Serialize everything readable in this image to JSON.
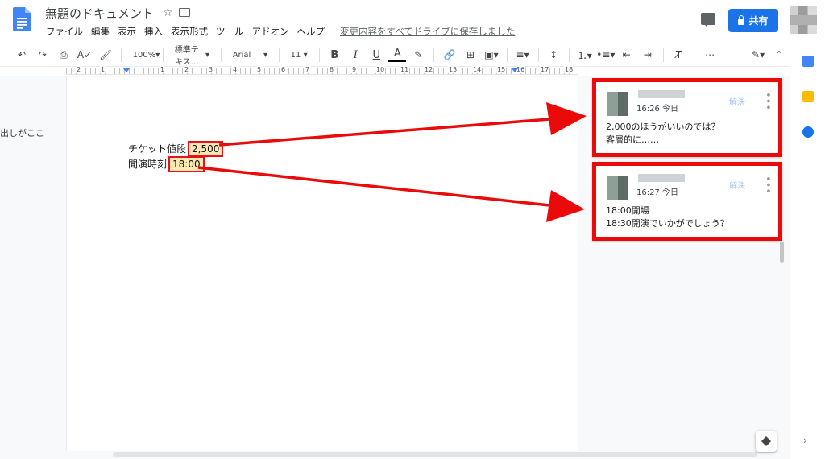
{
  "header": {
    "doc_title": "無題のドキュメント",
    "menu": [
      "ファイル",
      "編集",
      "表示",
      "挿入",
      "表示形式",
      "ツール",
      "アドオン",
      "ヘルプ"
    ],
    "save_status": "変更内容をすべてドライブに保存しました",
    "share_label": "共有"
  },
  "toolbar": {
    "zoom": "100%",
    "style": "標準テキス…",
    "font": "Arial",
    "size": "11",
    "bold": "B",
    "italic": "I",
    "underline": "U",
    "text_color": "A",
    "more": "⋯"
  },
  "ruler": {
    "labels": [
      "2",
      "1",
      "1",
      "2",
      "3",
      "4",
      "5",
      "6",
      "7",
      "8",
      "9",
      "10",
      "11",
      "12",
      "13",
      "14",
      "15",
      "16",
      "17",
      "18"
    ]
  },
  "outline": {
    "text": "出しがここ"
  },
  "document": {
    "line1_label": "チケット値段",
    "line1_value": "2,500",
    "line2_label": "開演時刻",
    "line2_value": "18:00"
  },
  "comments": [
    {
      "time": "16:26 今日",
      "resolve": "解決",
      "line1": "2,000のほうがいいのでは？",
      "line2": "客層的に……"
    },
    {
      "time": "16:27 今日",
      "resolve": "解決",
      "line1": "18:00開場",
      "line2": "18:30開演でいかがでしょう？"
    }
  ],
  "icons": {
    "doc_logo": "google-docs-icon",
    "calendar": "calendar-icon",
    "keep": "keep-icon",
    "tasks": "tasks-icon"
  },
  "colors": {
    "share_button": "#1a73e8",
    "annotation_red": "#ea0a0a",
    "highlight": "#fce8b2"
  }
}
